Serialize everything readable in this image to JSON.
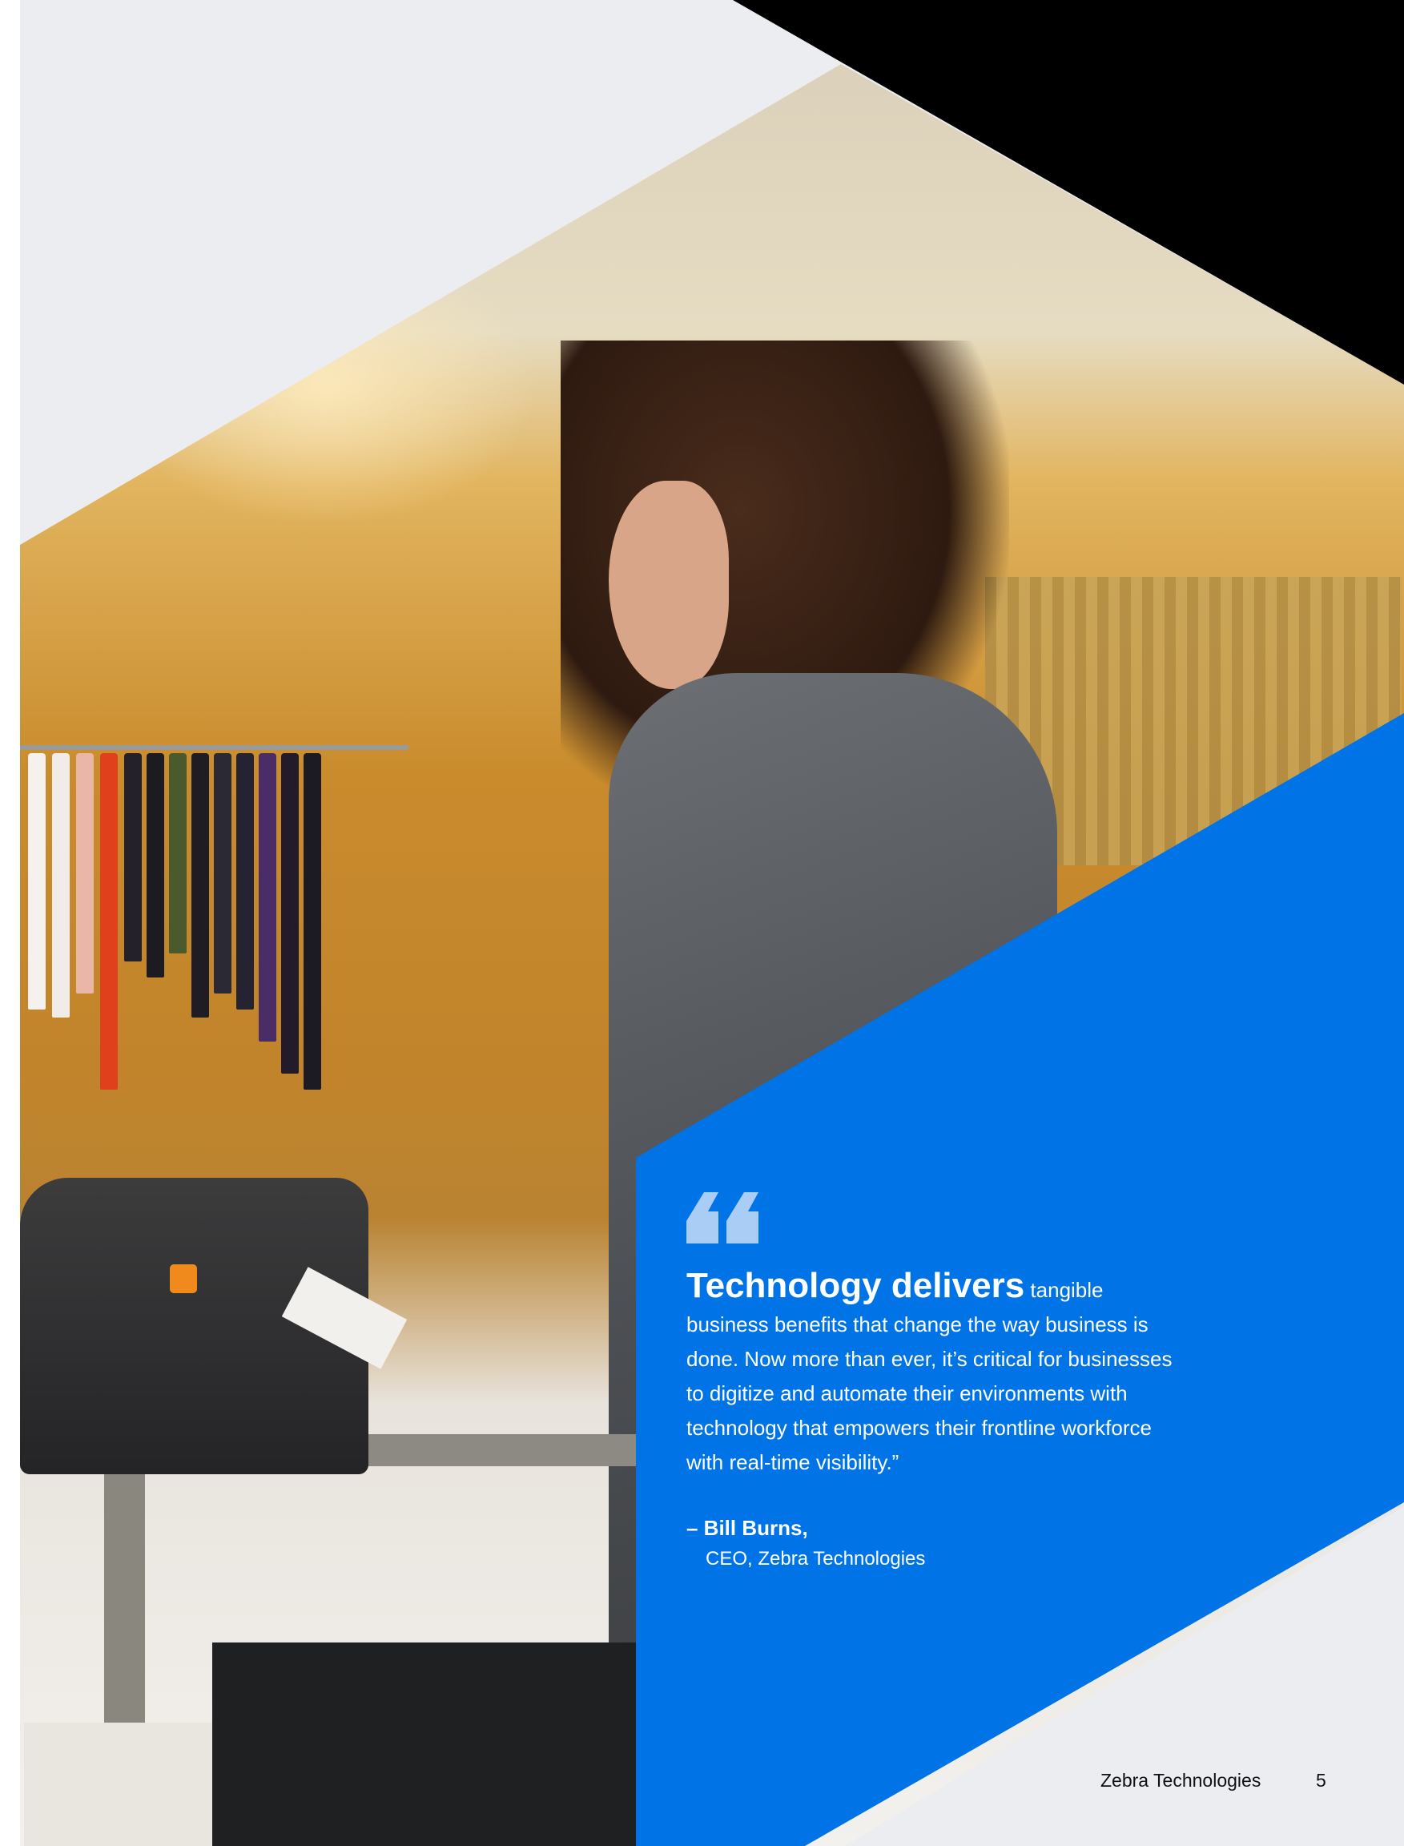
{
  "quote": {
    "lead": "Technology delivers",
    "body": " tangible business benefits that change the way business is done. Now more than ever, it’s critical for businesses to digitize and automate their environments with technology that empowers their frontline workforce with real-time visibility.”"
  },
  "attribution": {
    "name": "– Bill Burns,",
    "role": "CEO, Zebra Technologies"
  },
  "footer": {
    "company": "Zebra Technologies",
    "page_number": "5"
  },
  "colors": {
    "accent_blue": "#0073e6",
    "quote_mark": "#a9cdf5",
    "background": "#ecedf1"
  },
  "image": {
    "icon": "quote-icon"
  }
}
